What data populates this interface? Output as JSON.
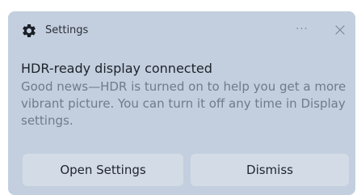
{
  "toast": {
    "app_name": "Settings",
    "app_icon": "gear-icon",
    "more_label": "···",
    "close_icon": "close-icon",
    "headline": "HDR-ready display connected",
    "body": "Good news—HDR is turned on to help you get a more vibrant picture. You can turn it off any time in Display settings.",
    "buttons": [
      {
        "label": "Open Settings"
      },
      {
        "label": "Dismiss"
      }
    ]
  },
  "colors": {
    "toast_background": "#c3cfde",
    "button_background": "#d3dce6",
    "headline_text": "#1d222b",
    "body_text": "#6f7b8a"
  }
}
